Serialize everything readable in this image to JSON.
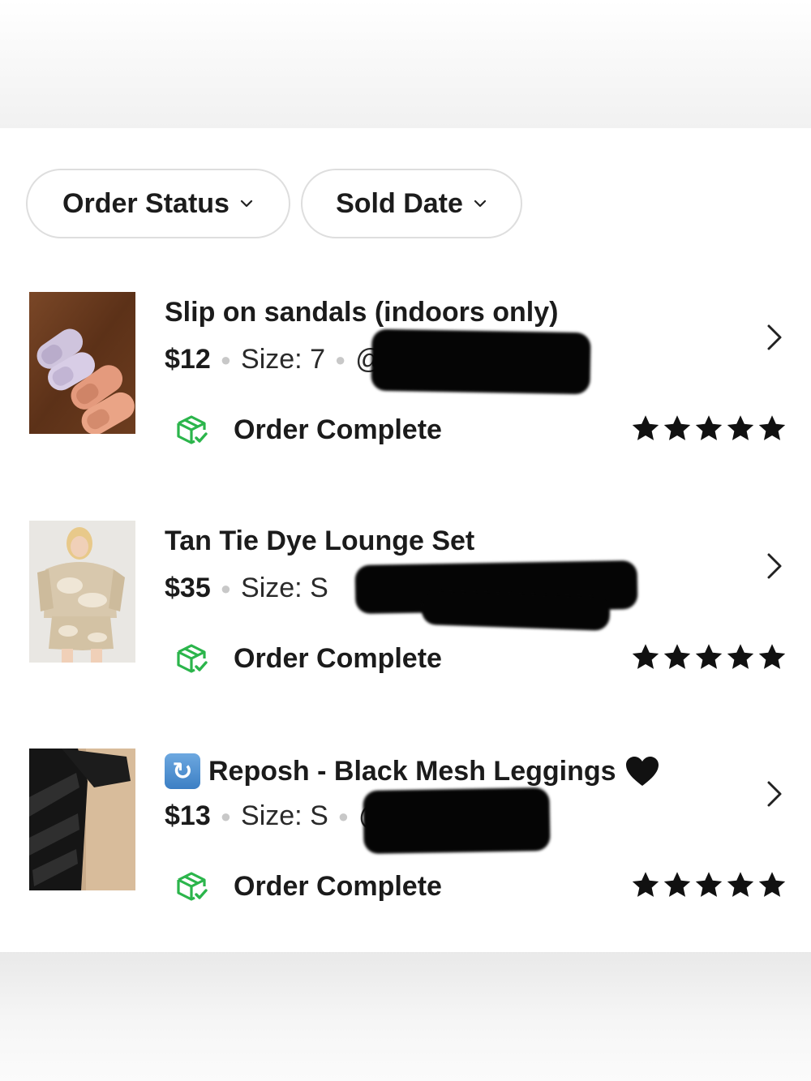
{
  "filters": [
    {
      "label": "Order Status"
    },
    {
      "label": "Sold Date"
    }
  ],
  "orders": [
    {
      "title": "Slip on sandals (indoors only)",
      "price": "$12",
      "size": "Size: 7",
      "seller_visible": "@",
      "status": "Order Complete",
      "rating": 5
    },
    {
      "title": "Tan Tie Dye Lounge Set",
      "price": "$35",
      "size": "Size: S",
      "seller_visible": "",
      "status": "Order Complete",
      "rating": 5
    },
    {
      "title": "Reposh - Black Mesh Leggings",
      "price": "$13",
      "size": "Size: S",
      "seller_visible": "@",
      "status": "Order Complete",
      "rating": 5,
      "badge_icon": "repost-icon",
      "trailing_icon": "black-heart-icon"
    }
  ],
  "colors": {
    "status_green": "#2bb54b",
    "star": "#111111",
    "redaction": "#050505"
  }
}
